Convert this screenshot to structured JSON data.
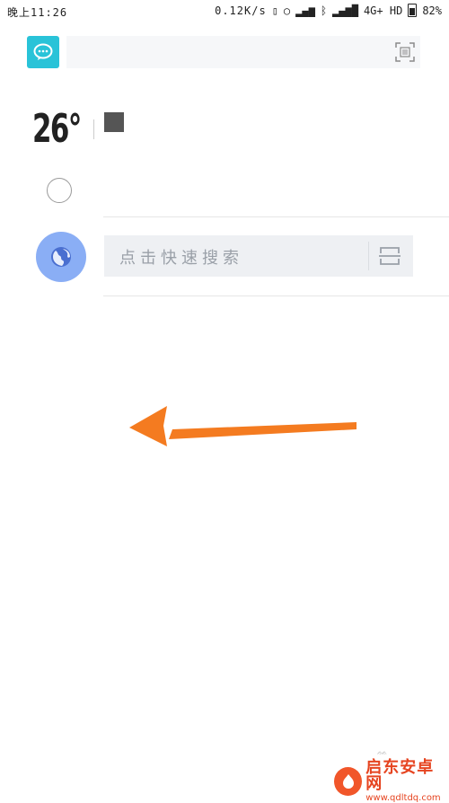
{
  "status_bar": {
    "time": "晚上11:26",
    "speed": "0.12K/s",
    "network": "4G+ HD",
    "battery": "82%"
  },
  "weather": {
    "temperature": "26°"
  },
  "search": {
    "placeholder": "点击快速搜索"
  },
  "watermark": {
    "title": "启东安卓网",
    "url": "www.qdltdq.com"
  },
  "colors": {
    "chat_button": "#29c3d8",
    "globe_button": "#8aaef5",
    "arrow": "#f47b20",
    "watermark": "#e64420"
  },
  "icons": {
    "chat": "chat-bubble-icon",
    "scan": "scan-icon",
    "globe": "globe-icon",
    "ring": "ring-icon"
  }
}
